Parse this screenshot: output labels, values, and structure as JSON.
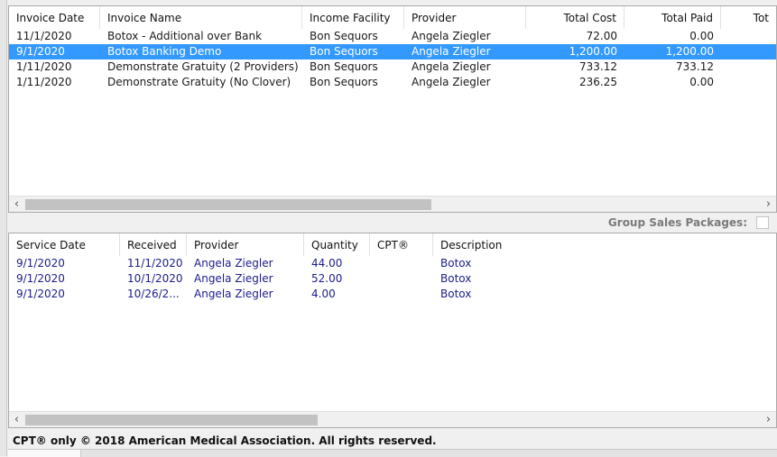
{
  "invoices": {
    "columns": [
      "Invoice Date",
      "Invoice Name",
      "Income Facility",
      "Provider",
      "Total Cost",
      "Total Paid",
      "Tot"
    ],
    "rows": [
      {
        "date": "11/1/2020",
        "name": "Botox - Additional over Bank",
        "facility": "Bon Sequors",
        "provider": "Angela Ziegler",
        "cost": "72.00",
        "paid": "0.00",
        "selected": false
      },
      {
        "date": "9/1/2020",
        "name": "Botox Banking Demo",
        "facility": "Bon Sequors",
        "provider": "Angela Ziegler",
        "cost": "1,200.00",
        "paid": "1,200.00",
        "selected": true
      },
      {
        "date": "1/11/2020",
        "name": "Demonstrate Gratuity (2 Providers)",
        "facility": "Bon Sequors",
        "provider": "Angela Ziegler",
        "cost": "733.12",
        "paid": "733.12",
        "selected": false
      },
      {
        "date": "1/11/2020",
        "name": "Demonstrate Gratuity (No Clover)",
        "facility": "Bon Sequors",
        "provider": "Angela Ziegler",
        "cost": "236.25",
        "paid": "0.00",
        "selected": false
      }
    ]
  },
  "group_sales": {
    "label": "Group Sales Packages:",
    "checked": false
  },
  "items": {
    "columns": [
      "Service Date",
      "Received",
      "Provider",
      "Quantity",
      "CPT®",
      "Description"
    ],
    "rows": [
      {
        "service_date": "9/1/2020",
        "received": "11/1/2020",
        "provider": "Angela Ziegler",
        "quantity": "44.00",
        "cpt": "",
        "description": "Botox"
      },
      {
        "service_date": "9/1/2020",
        "received": "10/1/2020",
        "provider": "Angela Ziegler",
        "quantity": "52.00",
        "cpt": "",
        "description": "Botox"
      },
      {
        "service_date": "9/1/2020",
        "received": "10/26/2...",
        "provider": "Angela Ziegler",
        "quantity": "4.00",
        "cpt": "",
        "description": "Botox"
      }
    ]
  },
  "footer": {
    "text": "CPT® only © 2018 American Medical Association. All rights reserved."
  },
  "icons": {
    "left": "‹",
    "right": "›"
  }
}
